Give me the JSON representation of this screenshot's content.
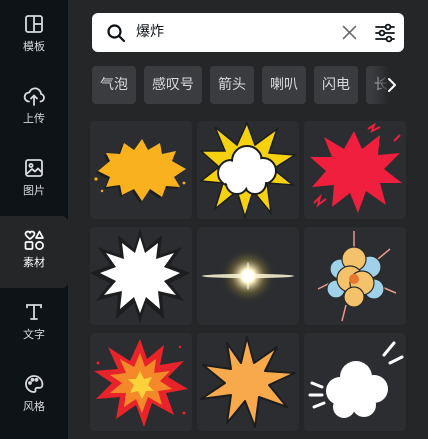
{
  "sidebar": {
    "items": [
      {
        "label": "模板",
        "icon": "layout-icon"
      },
      {
        "label": "上传",
        "icon": "upload-cloud-icon"
      },
      {
        "label": "图片",
        "icon": "image-icon"
      },
      {
        "label": "素材",
        "icon": "shapes-icon"
      },
      {
        "label": "文字",
        "icon": "text-icon"
      },
      {
        "label": "风格",
        "icon": "palette-icon"
      }
    ],
    "active": "素材"
  },
  "search": {
    "value": "爆炸",
    "search_icon": "search-icon",
    "clear_icon": "close-icon",
    "filter_icon": "sliders-icon"
  },
  "chips": [
    "气泡",
    "感叹号",
    "箭头",
    "喇叭",
    "闪电",
    "长方"
  ],
  "results": {
    "items": [
      {
        "name": "yellow-explosion-burst",
        "color": "#f9b21d"
      },
      {
        "name": "white-cloud-yellow-burst",
        "color": "#f5d10f"
      },
      {
        "name": "red-explosion-splash",
        "color": "#ef1f3d"
      },
      {
        "name": "white-spiky-burst",
        "color": "#ffffff"
      },
      {
        "name": "light-flare",
        "color": "#fff8d8"
      },
      {
        "name": "comic-smoke-explosion",
        "color": "#f4c26a"
      },
      {
        "name": "red-orange-explosion",
        "color": "#f24a2a"
      },
      {
        "name": "orange-star-burst",
        "color": "#f7a94b"
      },
      {
        "name": "white-cloud-burst",
        "color": "#ffffff"
      }
    ]
  },
  "colors": {
    "rail": "#0e1318",
    "panel": "#252627",
    "chip": "#3a3c3f",
    "tile": "#2b2d30"
  }
}
